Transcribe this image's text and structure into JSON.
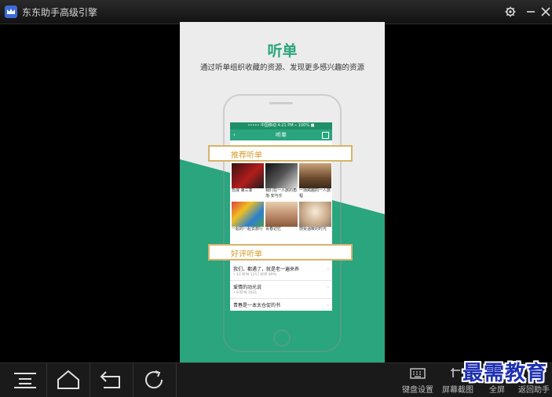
{
  "window": {
    "title": "东东助手高级引擎"
  },
  "screen": {
    "title": "听单",
    "subtitle": "通过听单组织收藏的资源、发现更多感兴趣的资源",
    "phone": {
      "status": "••••• 中国移动   4:21 PM   ⌁ 100% ■",
      "nav_title": "听单",
      "section_recommended": "推荐听单",
      "section_top_rated": "好评听单",
      "thumbs": [
        {
          "caption": "恐浪 第三季"
        },
        {
          "caption": "我们在一人旅的角落·安与乐"
        },
        {
          "caption": "一场跨越的一人旅程"
        },
        {
          "caption": "一起的一起去旅行"
        },
        {
          "caption": "青春记忆"
        },
        {
          "caption": "感受温暖的时光"
        }
      ],
      "list": [
        {
          "title": "我们，都遇了，就是老一遍来养",
          "meta": "• 12  听书  1257  好评 89%"
        },
        {
          "title": "爱情的动光说",
          "meta": "• 9  听书  1021"
        },
        {
          "title": "青春是一本太仓促的书",
          "meta": ""
        }
      ]
    }
  },
  "toolbar": {
    "keyboard_label": "键盘设置",
    "screenshot_label": "屏幕截图",
    "fullscreen_label": "全屏",
    "return_label": "返回助手"
  },
  "watermark": "最需教育",
  "colors": {
    "accent": "#2aa57e",
    "banner_border": "#d7b46a",
    "banner_text": "#d49c2a"
  }
}
